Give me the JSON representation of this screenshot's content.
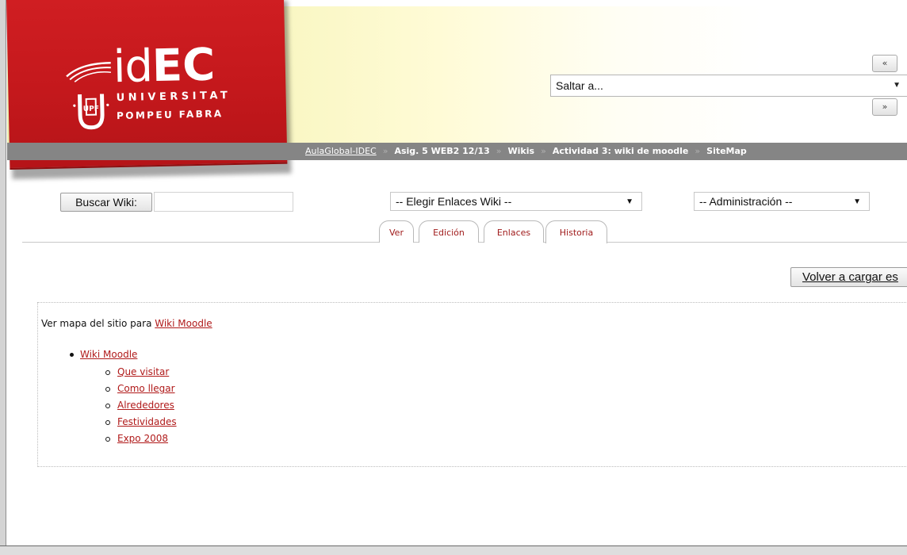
{
  "header": {
    "logo": {
      "brand_light": "id",
      "brand_heavy": "EC",
      "university_line1": "UNIVERSITAT",
      "university_line2": "POMPEU FABRA",
      "seal_text": "UPF"
    },
    "jump": {
      "prev_label": "«",
      "next_label": "»",
      "select_value": "Saltar a..."
    }
  },
  "breadcrumb": {
    "items": [
      {
        "label": "AulaGlobal-IDEC"
      },
      {
        "label": "Asig. 5 WEB2 12/13"
      },
      {
        "label": "Wikis"
      },
      {
        "label": "Actividad 3: wiki de moodle"
      },
      {
        "label": "SiteMap"
      }
    ],
    "separator": "»"
  },
  "wiki_toolbar": {
    "search_button": "Buscar Wiki:",
    "search_value": "",
    "links_select": "-- Elegir Enlaces Wiki --",
    "admin_select": "-- Administración --"
  },
  "tabs": [
    {
      "label": "Ver"
    },
    {
      "label": "Edición"
    },
    {
      "label": "Enlaces"
    },
    {
      "label": "Historia"
    }
  ],
  "reload_button": "Volver a cargar es",
  "sitemap": {
    "intro": "Ver mapa del sitio para ",
    "intro_link": "Wiki Moodle",
    "root": "Wiki Moodle",
    "children": [
      "Que visitar",
      "Como llegar",
      "Alrededores",
      "Festividades",
      "Expo 2008"
    ]
  },
  "colors": {
    "brand_red": "#c8191d",
    "link_red": "#b01a1a",
    "breadcrumb_bg": "#858585"
  }
}
